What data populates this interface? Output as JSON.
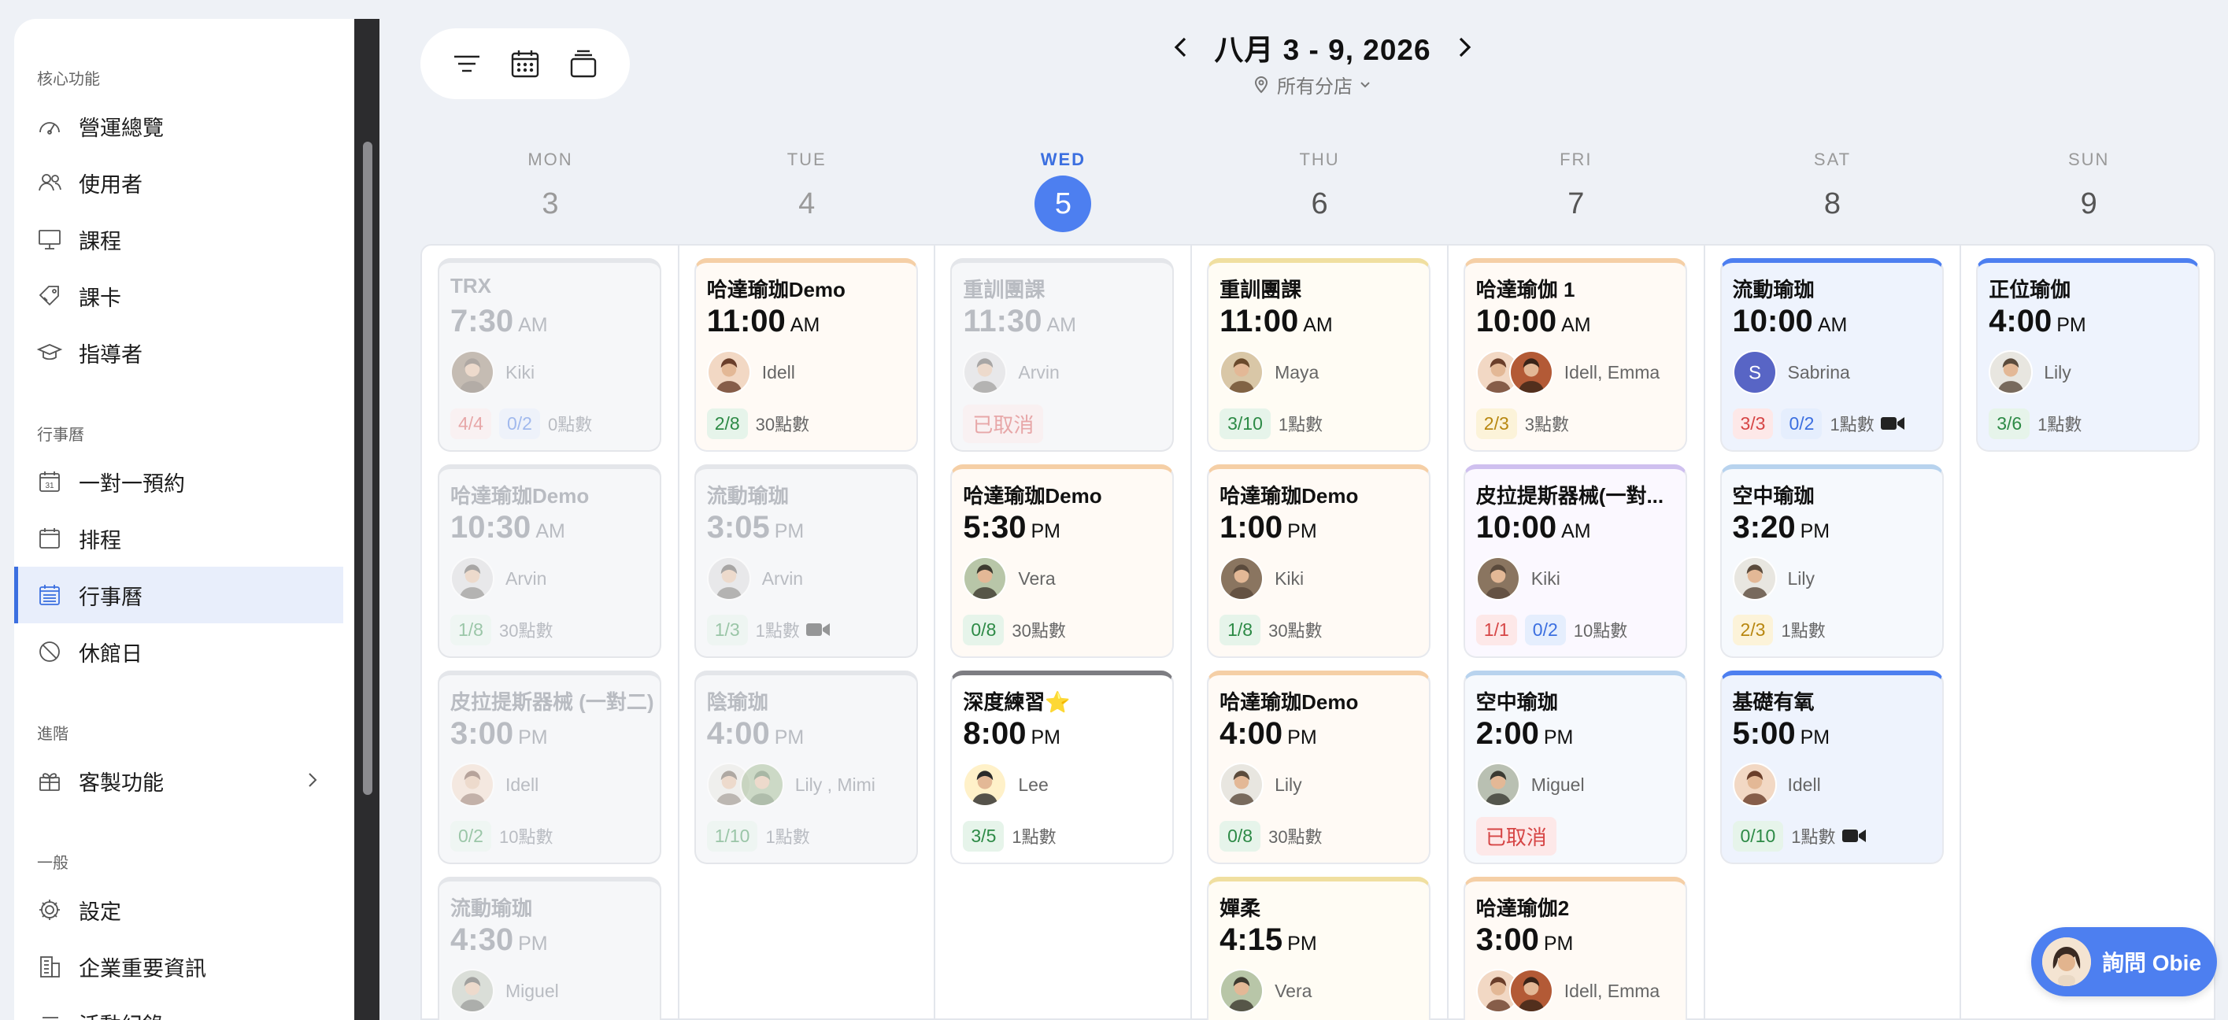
{
  "sidebar": {
    "sections": [
      {
        "title": "核心功能",
        "items": [
          {
            "label": "營運總覽",
            "icon": "gauge-icon"
          },
          {
            "label": "使用者",
            "icon": "users-icon"
          },
          {
            "label": "課程",
            "icon": "board-icon"
          },
          {
            "label": "課卡",
            "icon": "tag-icon"
          },
          {
            "label": "指導者",
            "icon": "mortarboard-icon"
          }
        ]
      },
      {
        "title": "行事曆",
        "items": [
          {
            "label": "一對一預約",
            "icon": "calendar-31-icon"
          },
          {
            "label": "排程",
            "icon": "calendar-blank-icon"
          },
          {
            "label": "行事曆",
            "icon": "calendar-grid-icon",
            "active": true
          },
          {
            "label": "休館日",
            "icon": "prohibited-icon"
          }
        ]
      },
      {
        "title": "進階",
        "items": [
          {
            "label": "客製功能",
            "icon": "gift-icon"
          }
        ]
      },
      {
        "title": "一般",
        "items": [
          {
            "label": "設定",
            "icon": "gear-icon"
          },
          {
            "label": "企業重要資訊",
            "icon": "building-icon"
          },
          {
            "label": "活動紀錄",
            "icon": "list-icon"
          }
        ]
      }
    ]
  },
  "header": {
    "week_label": "八月 3 - 9, 2026",
    "branch_label": "所有分店"
  },
  "days": [
    {
      "dow": "MON",
      "num": "3",
      "state": "past"
    },
    {
      "dow": "TUE",
      "num": "4",
      "state": "past"
    },
    {
      "dow": "WED",
      "num": "5",
      "state": "today"
    },
    {
      "dow": "THU",
      "num": "6",
      "state": "future"
    },
    {
      "dow": "FRI",
      "num": "7",
      "state": "future"
    },
    {
      "dow": "SAT",
      "num": "8",
      "state": "future"
    },
    {
      "dow": "SUN",
      "num": "9",
      "state": "future"
    }
  ],
  "events": [
    {
      "col": 0,
      "row": 0,
      "title": "TRX",
      "time": "7:30",
      "ampm": "AM",
      "instructor": "Kiki",
      "badges": [
        {
          "text": "4/4",
          "kind": "red"
        },
        {
          "text": "0/2",
          "kind": "blue"
        }
      ],
      "points": "0點數",
      "past": true,
      "theme": "gray"
    },
    {
      "col": 0,
      "row": 1,
      "title": "哈達瑜珈Demo",
      "time": "10:30",
      "ampm": "AM",
      "instructor": "Arvin",
      "badges": [
        {
          "text": "1/8",
          "kind": "green"
        }
      ],
      "points": "30點數",
      "past": true,
      "theme": "gray"
    },
    {
      "col": 0,
      "row": 2,
      "title": "皮拉提斯器械 (一對二)",
      "time": "3:00",
      "ampm": "PM",
      "instructor": "Idell",
      "badges": [
        {
          "text": "0/2",
          "kind": "green"
        }
      ],
      "points": "10點數",
      "past": true,
      "theme": "gray"
    },
    {
      "col": 0,
      "row": 3,
      "title": "流動瑜珈",
      "time": "4:30",
      "ampm": "PM",
      "instructor": "Miguel",
      "badges": [],
      "points": "",
      "past": true,
      "theme": "gray"
    },
    {
      "col": 1,
      "row": 0,
      "title": "哈達瑜珈Demo",
      "time": "11:00",
      "ampm": "AM",
      "instructor": "Idell",
      "badges": [
        {
          "text": "2/8",
          "kind": "green"
        }
      ],
      "points": "30點數",
      "past": false,
      "theme": "orange"
    },
    {
      "col": 1,
      "row": 1,
      "title": "流動瑜珈",
      "time": "3:05",
      "ampm": "PM",
      "instructor": "Arvin",
      "badges": [
        {
          "text": "1/3",
          "kind": "green"
        }
      ],
      "points": "1點數",
      "video": true,
      "past": true,
      "theme": "gray"
    },
    {
      "col": 1,
      "row": 2,
      "title": "陰瑜珈",
      "time": "4:00",
      "ampm": "PM",
      "instructor": "Lily , Mimi",
      "avatars": 2,
      "badges": [
        {
          "text": "1/10",
          "kind": "green"
        }
      ],
      "points": "1點數",
      "past": true,
      "theme": "gray"
    },
    {
      "col": 2,
      "row": 0,
      "title": "重訓團課",
      "time": "11:30",
      "ampm": "AM",
      "instructor": "Arvin",
      "badges": [],
      "cancelled": "已取消",
      "points": "",
      "past": true,
      "theme": "gray"
    },
    {
      "col": 2,
      "row": 1,
      "title": "哈達瑜珈Demo",
      "time": "5:30",
      "ampm": "PM",
      "instructor": "Vera",
      "badges": [
        {
          "text": "0/8",
          "kind": "green"
        }
      ],
      "points": "30點數",
      "past": false,
      "theme": "orange"
    },
    {
      "col": 2,
      "row": 2,
      "title": "深度練習⭐",
      "time": "8:00",
      "ampm": "PM",
      "instructor": "Lee",
      "badges": [
        {
          "text": "3/5",
          "kind": "green"
        }
      ],
      "points": "1點數",
      "past": false,
      "theme": "dark"
    },
    {
      "col": 3,
      "row": 0,
      "title": "重訓團課",
      "time": "11:00",
      "ampm": "AM",
      "instructor": "Maya",
      "badges": [
        {
          "text": "3/10",
          "kind": "green"
        }
      ],
      "points": "1點數",
      "past": false,
      "theme": "yellow"
    },
    {
      "col": 3,
      "row": 1,
      "title": "哈達瑜珈Demo",
      "time": "1:00",
      "ampm": "PM",
      "instructor": "Kiki",
      "badges": [
        {
          "text": "1/8",
          "kind": "green"
        }
      ],
      "points": "30點數",
      "past": false,
      "theme": "orange"
    },
    {
      "col": 3,
      "row": 2,
      "title": "哈達瑜珈Demo",
      "time": "4:00",
      "ampm": "PM",
      "instructor": "Lily",
      "badges": [
        {
          "text": "0/8",
          "kind": "green"
        }
      ],
      "points": "30點數",
      "past": false,
      "theme": "orange"
    },
    {
      "col": 3,
      "row": 3,
      "title": "嬋柔",
      "time": "4:15",
      "ampm": "PM",
      "instructor": "Vera",
      "badges": [],
      "points": "",
      "past": false,
      "theme": "yellow"
    },
    {
      "col": 4,
      "row": 0,
      "title": "哈達瑜伽 1",
      "time": "10:00",
      "ampm": "AM",
      "instructor": "Idell, Emma",
      "avatars": 2,
      "badges": [
        {
          "text": "2/3",
          "kind": "yellow"
        }
      ],
      "points": "3點數",
      "past": false,
      "theme": "orange"
    },
    {
      "col": 4,
      "row": 1,
      "title": "皮拉提斯器械(一對...",
      "time": "10:00",
      "ampm": "AM",
      "instructor": "Kiki",
      "badges": [
        {
          "text": "1/1",
          "kind": "red"
        },
        {
          "text": "0/2",
          "kind": "blue"
        }
      ],
      "points": "10點數",
      "past": false,
      "theme": "purple"
    },
    {
      "col": 4,
      "row": 2,
      "title": "空中瑜珈",
      "time": "2:00",
      "ampm": "PM",
      "instructor": "Miguel",
      "badges": [],
      "cancelled": "已取消",
      "points": "",
      "past": false,
      "theme": "lblue"
    },
    {
      "col": 4,
      "row": 3,
      "title": "哈達瑜伽2",
      "time": "3:00",
      "ampm": "PM",
      "instructor": "Idell, Emma",
      "avatars": 2,
      "badges": [],
      "points": "",
      "past": false,
      "theme": "orange"
    },
    {
      "col": 5,
      "row": 0,
      "title": "流動瑜珈",
      "time": "10:00",
      "ampm": "AM",
      "instructor": "Sabrina",
      "initial": "S",
      "badges": [
        {
          "text": "3/3",
          "kind": "red"
        },
        {
          "text": "0/2",
          "kind": "blue"
        }
      ],
      "points": "1點數",
      "video": true,
      "past": false,
      "theme": "blue"
    },
    {
      "col": 5,
      "row": 1,
      "title": "空中瑜珈",
      "time": "3:20",
      "ampm": "PM",
      "instructor": "Lily",
      "badges": [
        {
          "text": "2/3",
          "kind": "yellow"
        }
      ],
      "points": "1點數",
      "past": false,
      "theme": "lblue"
    },
    {
      "col": 5,
      "row": 2,
      "title": "基礎有氧",
      "time": "5:00",
      "ampm": "PM",
      "instructor": "Idell",
      "badges": [
        {
          "text": "0/10",
          "kind": "green"
        }
      ],
      "points": "1點數",
      "video": true,
      "past": false,
      "theme": "blue"
    },
    {
      "col": 6,
      "row": 0,
      "title": "正位瑜伽",
      "time": "4:00",
      "ampm": "PM",
      "instructor": "Lily",
      "badges": [
        {
          "text": "3/6",
          "kind": "green"
        }
      ],
      "points": "1點數",
      "past": false,
      "theme": "blue"
    }
  ],
  "ask_button": {
    "label": "詢問 Obie"
  }
}
